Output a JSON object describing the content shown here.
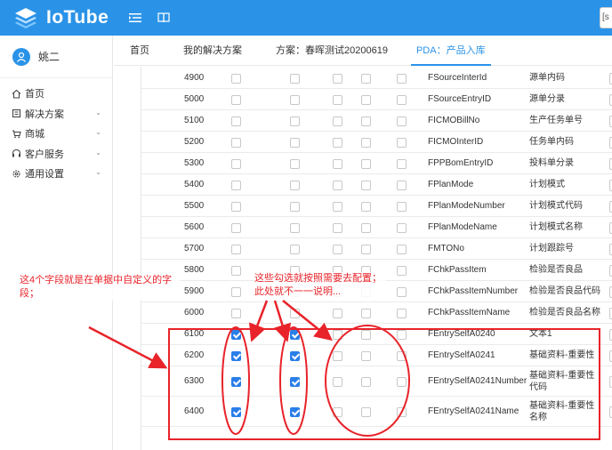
{
  "header": {
    "app_name": "IoTube",
    "search_value": "[s"
  },
  "sidebar": {
    "user_name": "姚二",
    "items": [
      {
        "label": "首页",
        "icon": "home-icon",
        "has_children": false
      },
      {
        "label": "解决方案",
        "icon": "solution-icon",
        "has_children": true
      },
      {
        "label": "商城",
        "icon": "cart-icon",
        "has_children": true
      },
      {
        "label": "客户服务",
        "icon": "headset-icon",
        "has_children": true
      },
      {
        "label": "通用设置",
        "icon": "gear-icon",
        "has_children": true
      }
    ]
  },
  "tabs": [
    {
      "label": "首页",
      "active": false
    },
    {
      "label": "我的解决方案",
      "active": false
    },
    {
      "label": "方案：春晖测试20200619",
      "active": false
    },
    {
      "label": "PDA：产品入库",
      "active": true
    }
  ],
  "table": {
    "rows": [
      {
        "num": "4900",
        "field": "FSourceInterId",
        "label": "源单内码",
        "checks": [
          false,
          false,
          false,
          false,
          false
        ]
      },
      {
        "num": "5000",
        "field": "FSourceEntryID",
        "label": "源单分录",
        "checks": [
          false,
          false,
          false,
          false,
          false
        ]
      },
      {
        "num": "5100",
        "field": "FICMOBillNo",
        "label": "生产任务单号",
        "checks": [
          false,
          false,
          false,
          false,
          false
        ]
      },
      {
        "num": "5200",
        "field": "FICMOInterID",
        "label": "任务单内码",
        "checks": [
          false,
          false,
          false,
          false,
          false
        ]
      },
      {
        "num": "5300",
        "field": "FPPBomEntryID",
        "label": "投料单分录",
        "checks": [
          false,
          false,
          false,
          false,
          false
        ]
      },
      {
        "num": "5400",
        "field": "FPlanMode",
        "label": "计划模式",
        "checks": [
          false,
          false,
          false,
          false,
          false
        ]
      },
      {
        "num": "5500",
        "field": "FPlanModeNumber",
        "label": "计划模式代码",
        "checks": [
          false,
          false,
          false,
          false,
          false
        ]
      },
      {
        "num": "5600",
        "field": "FPlanModeName",
        "label": "计划模式名称",
        "checks": [
          false,
          false,
          false,
          false,
          false
        ]
      },
      {
        "num": "5700",
        "field": "FMTONo",
        "label": "计划跟踪号",
        "checks": [
          false,
          false,
          false,
          false,
          false
        ]
      },
      {
        "num": "5800",
        "field": "FChkPassItem",
        "label": "检验是否良品",
        "checks": [
          false,
          false,
          false,
          false,
          false
        ]
      },
      {
        "num": "5900",
        "field": "FChkPassItemNumber",
        "label": "检验是否良品代码",
        "checks": [
          false,
          false,
          false,
          false,
          false
        ]
      },
      {
        "num": "6000",
        "field": "FChkPassItemName",
        "label": "检验是否良品名称",
        "checks": [
          false,
          false,
          false,
          false,
          false
        ]
      },
      {
        "num": "6100",
        "field": "FEntrySelfA0240",
        "label": "文本1",
        "checks": [
          true,
          true,
          false,
          false,
          false
        ]
      },
      {
        "num": "6200",
        "field": "FEntrySelfA0241",
        "label": "基础资料-重要性",
        "checks": [
          true,
          true,
          false,
          false,
          false
        ]
      },
      {
        "num": "6300",
        "field": "FEntrySelfA0241Number",
        "label": "基础资料-重要性代码",
        "checks": [
          true,
          true,
          false,
          false,
          false
        ]
      },
      {
        "num": "6400",
        "field": "FEntrySelfA0241Name",
        "label": "基础资料-重要性名称",
        "checks": [
          true,
          true,
          false,
          false,
          false
        ]
      }
    ]
  },
  "annotations": {
    "left_note": "这4个字段就是在单据中自定义的字段；",
    "middle_note": "这些勾选就按照需要去配置；此处就不一一说明...",
    "color": "#e8232a"
  },
  "colors": {
    "header_bg": "#2a93e8",
    "accent": "#2a93e8",
    "checkbox_checked": "#2a7ee8"
  }
}
